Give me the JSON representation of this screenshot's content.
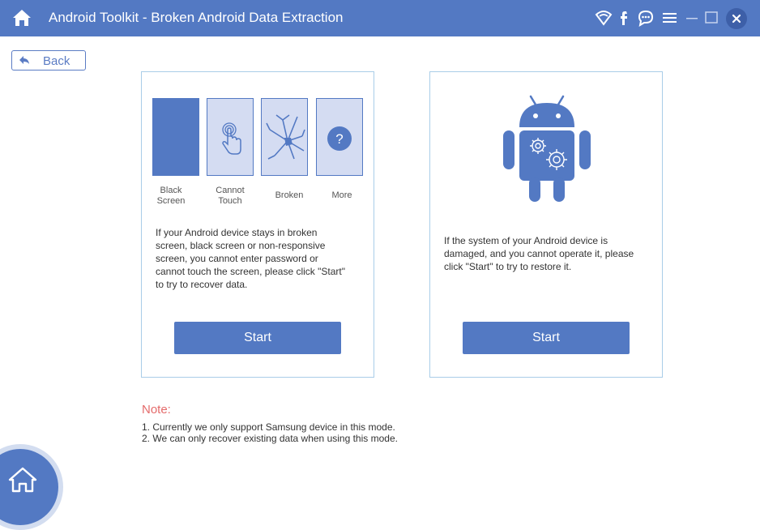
{
  "window": {
    "title": "Android Toolkit - Broken Android Data Extraction"
  },
  "toolbar_icons": [
    "home-icon",
    "wifi-icon",
    "facebook-icon",
    "chat-icon",
    "menu-icon",
    "minimize-icon",
    "maximize-icon",
    "close-icon"
  ],
  "back": {
    "label": "Back"
  },
  "left_card": {
    "tiles": [
      {
        "label": "Black Screen",
        "icon": ""
      },
      {
        "label": "Cannot Touch",
        "icon": "touch-icon"
      },
      {
        "label": "Broken",
        "icon": "broken-screen-icon"
      },
      {
        "label": "More",
        "icon": "question-icon"
      }
    ],
    "tile_label_lines": [
      [
        "Black",
        "Screen"
      ],
      [
        "Cannot",
        "Touch"
      ],
      [
        "Broken"
      ],
      [
        "More"
      ]
    ],
    "description_lines": [
      "If your Android device stays in broken",
      "screen, black screen or non-responsive",
      "screen, you cannot enter password or",
      "cannot touch the screen, please click \"Start\"",
      "to try to recover data."
    ],
    "start_label": "Start"
  },
  "right_card": {
    "icon": "android-gear-icon",
    "description_lines": [
      "If the system of your Android device is",
      "damaged, and you cannot operate it, please",
      "click \"Start\" to try to restore it."
    ],
    "start_label": "Start"
  },
  "note": {
    "title": "Note:",
    "lines": [
      "1. Currently we only support Samsung device in this mode.",
      "2. We can only recover existing data when using this mode."
    ]
  },
  "colors": {
    "accent": "#5379c3",
    "note_red": "#e46b6b",
    "card_border": "#a9cde8"
  }
}
